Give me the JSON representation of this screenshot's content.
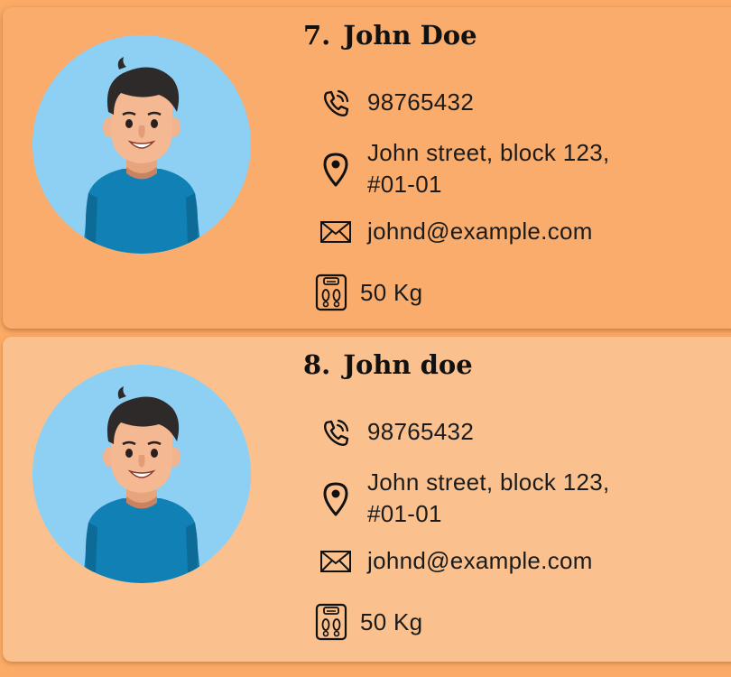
{
  "colors": {
    "page_bg": "#fbab66",
    "card_selected_bg": "#f9ac6b",
    "card_bg": "#fac18e",
    "avatar_bg": "#8ecff4",
    "text": "#1b1b1b"
  },
  "persons": [
    {
      "index": "7.",
      "name": "John Doe",
      "phone": "98765432",
      "address": "John street, block 123, #01-01",
      "email": "johnd@example.com",
      "weight": "50 Kg",
      "selected": true
    },
    {
      "index": "8.",
      "name": "John doe",
      "phone": "98765432",
      "address": "John street, block 123, #01-01",
      "email": "johnd@example.com",
      "weight": "50 Kg",
      "selected": false
    }
  ],
  "icons": {
    "avatar": "person-avatar-icon",
    "phone": "phone-icon",
    "address": "location-pin-icon",
    "email": "envelope-icon",
    "weight": "weighing-scale-icon"
  }
}
